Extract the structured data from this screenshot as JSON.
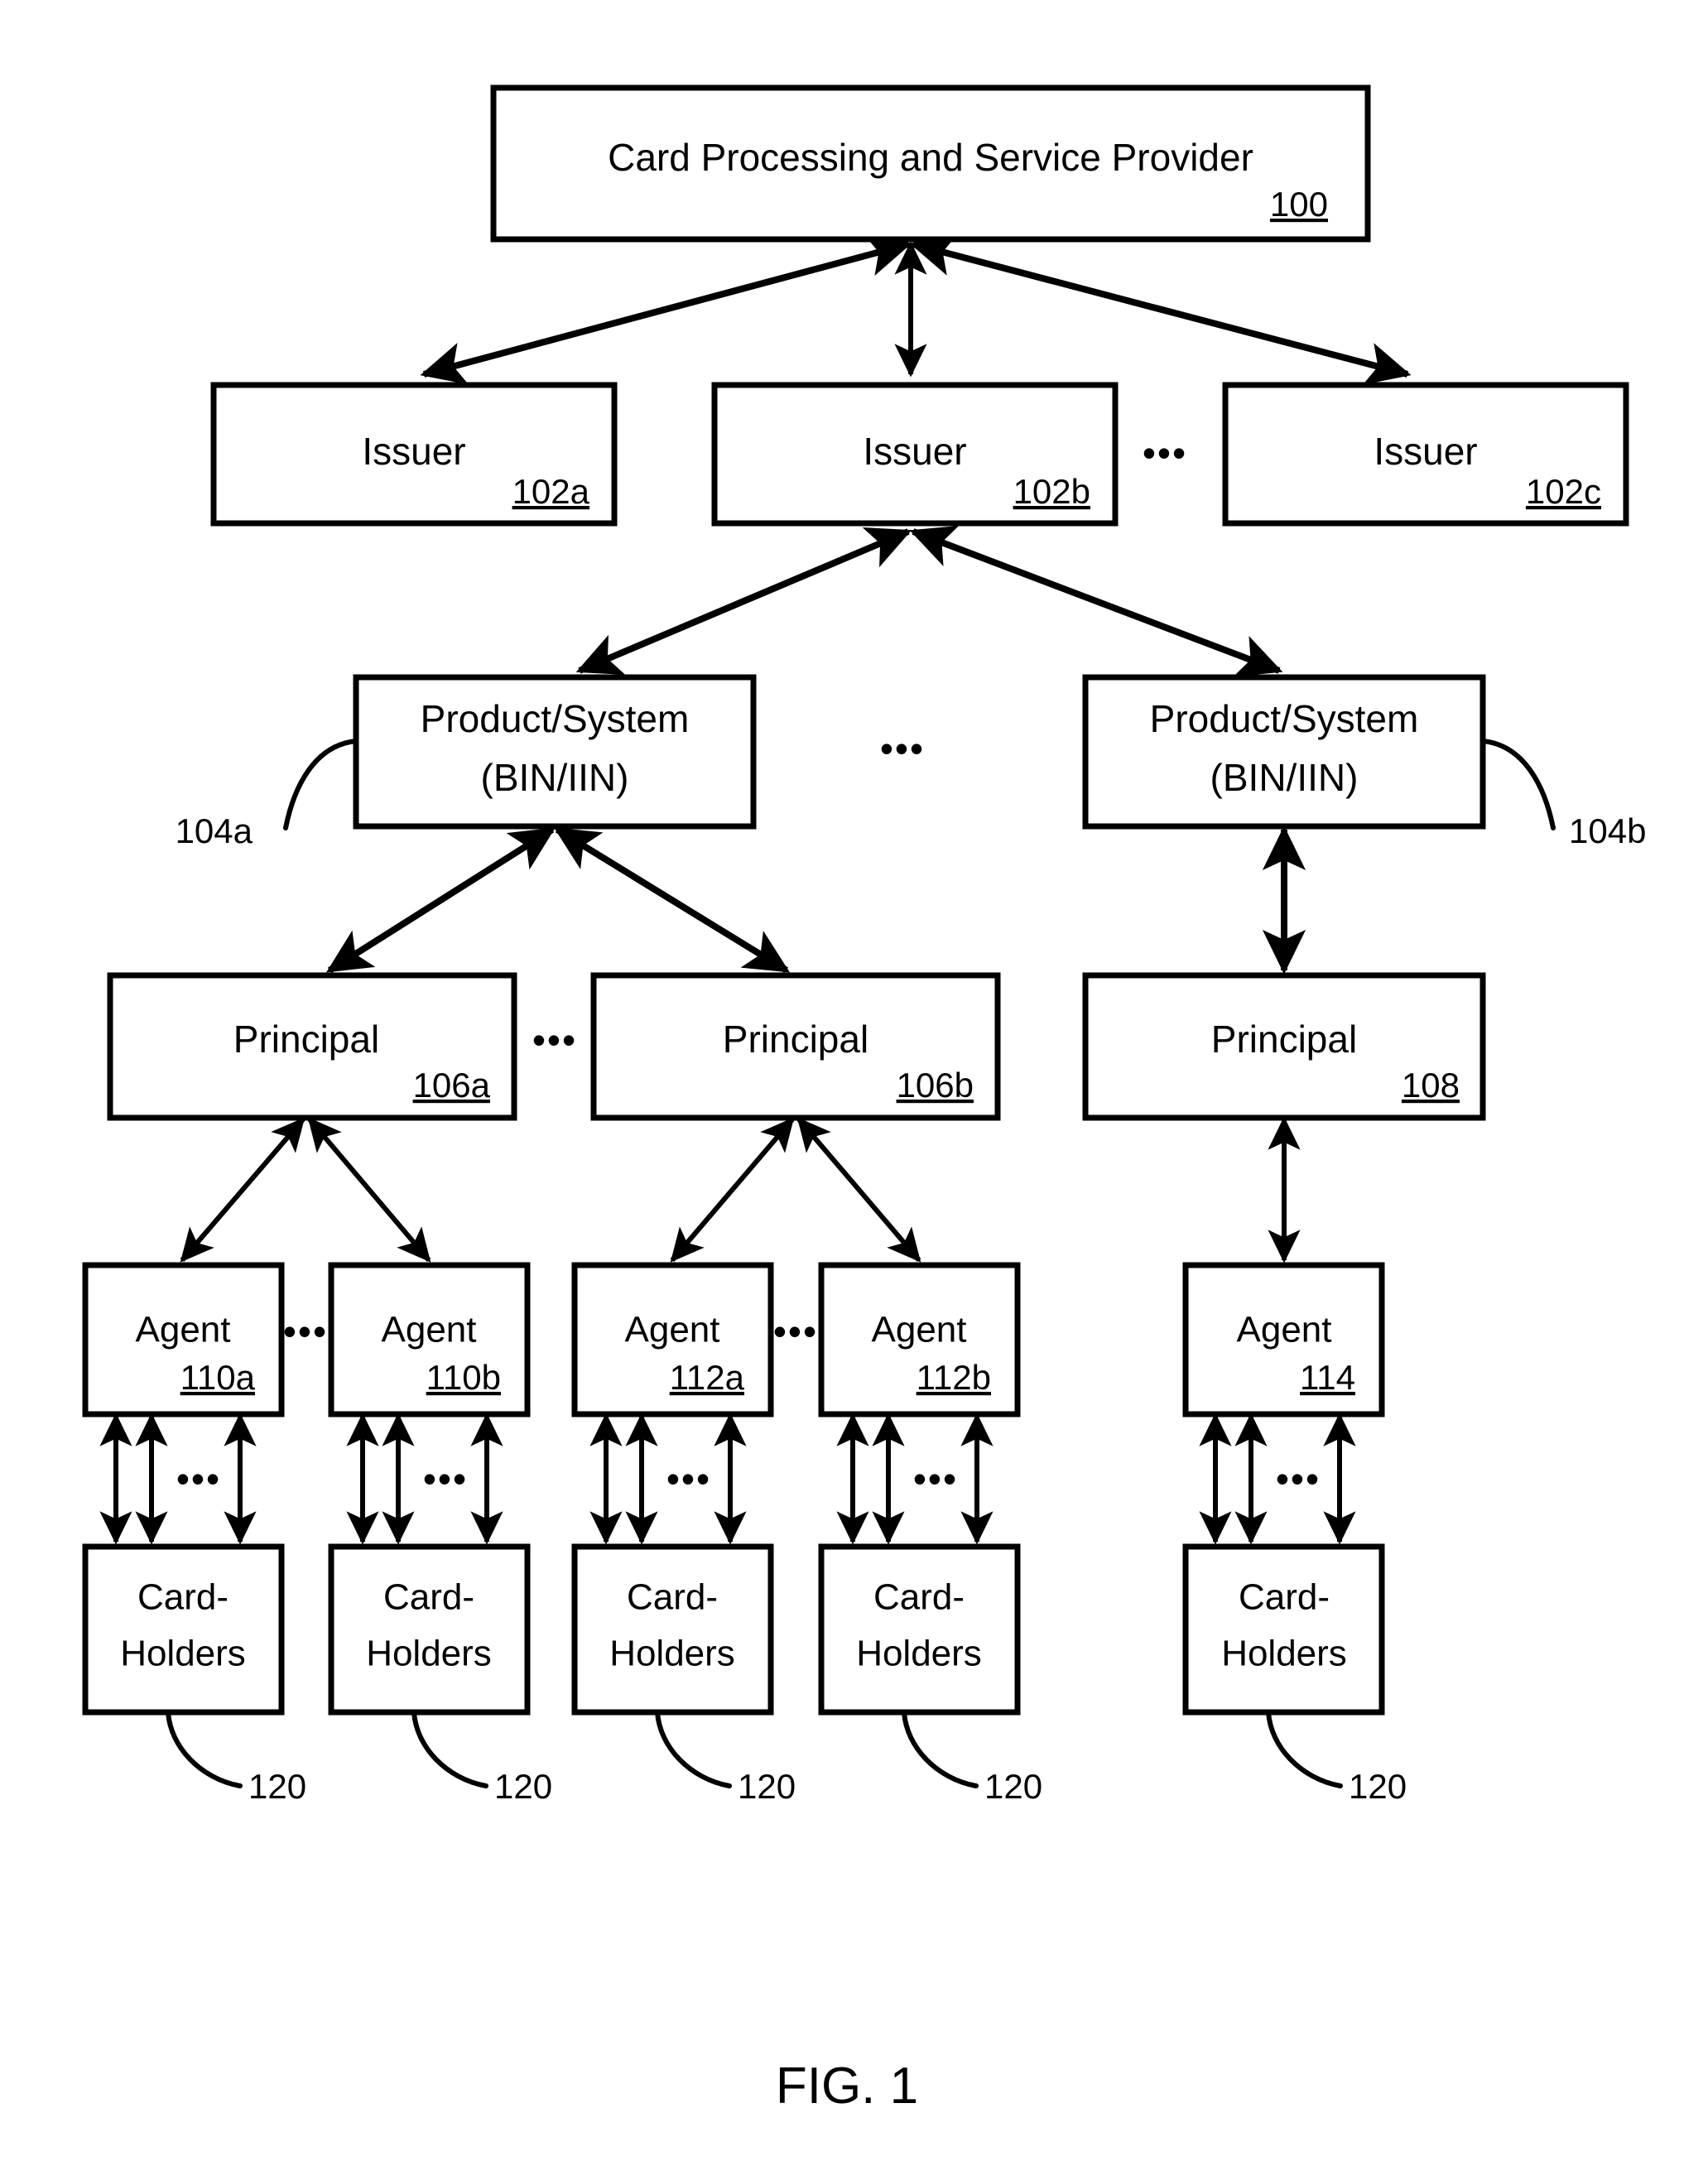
{
  "figure": {
    "caption": "FIG. 1"
  },
  "nodes": {
    "provider": {
      "label": "Card Processing and Service Provider",
      "ref": "100"
    },
    "issuers": [
      {
        "label": "Issuer",
        "ref": "102a"
      },
      {
        "label": "Issuer",
        "ref": "102b"
      },
      {
        "label": "Issuer",
        "ref": "102c"
      }
    ],
    "products": [
      {
        "line1": "Product/System",
        "line2": "(BIN/IIN)",
        "ref": "104a"
      },
      {
        "line1": "Product/System",
        "line2": "(BIN/IIN)",
        "ref": "104b"
      }
    ],
    "principals": [
      {
        "label": "Principal",
        "ref": "106a"
      },
      {
        "label": "Principal",
        "ref": "106b"
      },
      {
        "label": "Principal",
        "ref": "108"
      }
    ],
    "agents": [
      {
        "label": "Agent",
        "ref": "110a"
      },
      {
        "label": "Agent",
        "ref": "110b"
      },
      {
        "label": "Agent",
        "ref": "112a"
      },
      {
        "label": "Agent",
        "ref": "112b"
      },
      {
        "label": "Agent",
        "ref": "114"
      }
    ],
    "cardholders": [
      {
        "line1": "Card-",
        "line2": "Holders",
        "ref": "120"
      },
      {
        "line1": "Card-",
        "line2": "Holders",
        "ref": "120"
      },
      {
        "line1": "Card-",
        "line2": "Holders",
        "ref": "120"
      },
      {
        "line1": "Card-",
        "line2": "Holders",
        "ref": "120"
      },
      {
        "line1": "Card-",
        "line2": "Holders",
        "ref": "120"
      }
    ]
  },
  "ellipses": {
    "issuer_row": "•••",
    "product_row": "•••",
    "principal_row": "•••",
    "agent_row": "•••",
    "cardholder_link": "•••"
  },
  "colors": {
    "stroke": "#000000",
    "fill": "#ffffff",
    "text": "#000000"
  }
}
